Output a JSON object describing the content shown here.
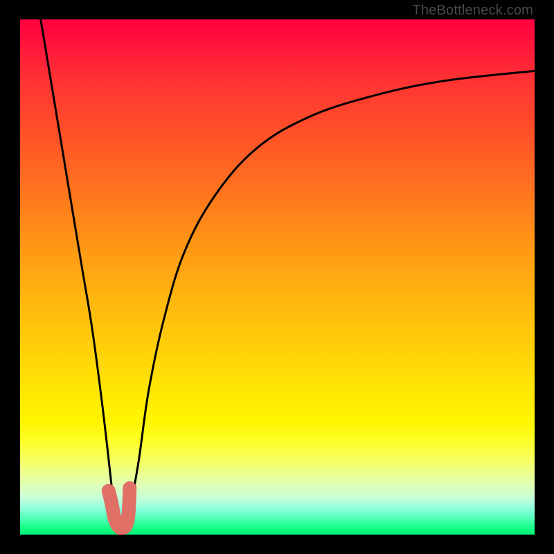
{
  "watermark": "TheBottleneck.com",
  "colors": {
    "frame": "#000000",
    "curve": "#000000",
    "marker": "#e07066",
    "gradient_top": "#ff0040",
    "gradient_bottom": "#00ef74"
  },
  "chart_data": {
    "type": "line",
    "title": "",
    "xlabel": "",
    "ylabel": "",
    "xlim": [
      0,
      100
    ],
    "ylim": [
      0,
      100
    ],
    "grid": false,
    "series": [
      {
        "name": "left-descent",
        "x": [
          4,
          6,
          8,
          10,
          12,
          14,
          16,
          17.5,
          18.5
        ],
        "values": [
          100,
          88,
          76,
          64,
          52,
          40,
          25,
          12,
          3
        ]
      },
      {
        "name": "right-rise",
        "x": [
          21,
          23,
          25,
          28,
          32,
          38,
          46,
          56,
          68,
          82,
          100
        ],
        "values": [
          3,
          14,
          28,
          42,
          55,
          66,
          75,
          81,
          85,
          88,
          90
        ]
      },
      {
        "name": "hook-marker",
        "x": [
          17.2,
          17.8,
          18.4,
          19.2,
          20.0,
          20.6,
          21.0,
          21.2,
          21.3
        ],
        "values": [
          8.5,
          6.0,
          3.0,
          1.5,
          1.3,
          1.8,
          3.4,
          6.0,
          9.0
        ]
      }
    ],
    "markers": [
      {
        "name": "dot-upper",
        "x": 17.2,
        "y": 8.5
      },
      {
        "name": "dot-lower",
        "x": 17.8,
        "y": 6.0
      }
    ]
  }
}
